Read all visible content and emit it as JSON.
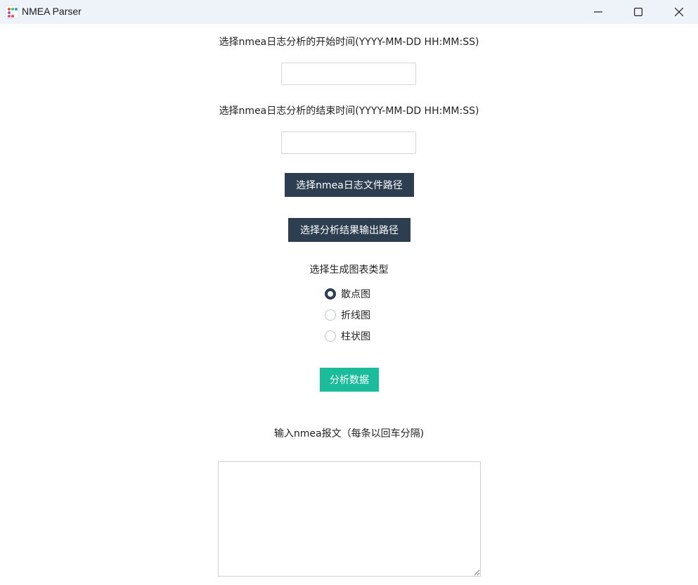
{
  "window": {
    "title": "NMEA Parser",
    "controls": [
      "minimize-icon",
      "maximize-icon",
      "close-icon"
    ]
  },
  "form": {
    "start_time_label": "选择nmea日志分析的开始时间(YYYY-MM-DD HH:MM:SS)",
    "start_time_value": "",
    "end_time_label": "选择nmea日志分析的结束时间(YYYY-MM-DD HH:MM:SS)",
    "end_time_value": "",
    "select_log_path_button": "选择nmea日志文件路径",
    "select_output_path_button": "选择分析结果输出路径",
    "chart_type_label": "选择生成图表类型",
    "chart_types": [
      {
        "label": "散点图",
        "checked": true
      },
      {
        "label": "折线图",
        "checked": false
      },
      {
        "label": "柱状图",
        "checked": false
      }
    ],
    "analyze_button": "分析数据",
    "nmea_input_label": "输入nmea报文（每条以回车分隔)",
    "nmea_input_value": ""
  },
  "colors": {
    "titlebar_bg": "#eef2f9",
    "dark_button": "#2c3e50",
    "teal_button": "#1abc9c"
  }
}
